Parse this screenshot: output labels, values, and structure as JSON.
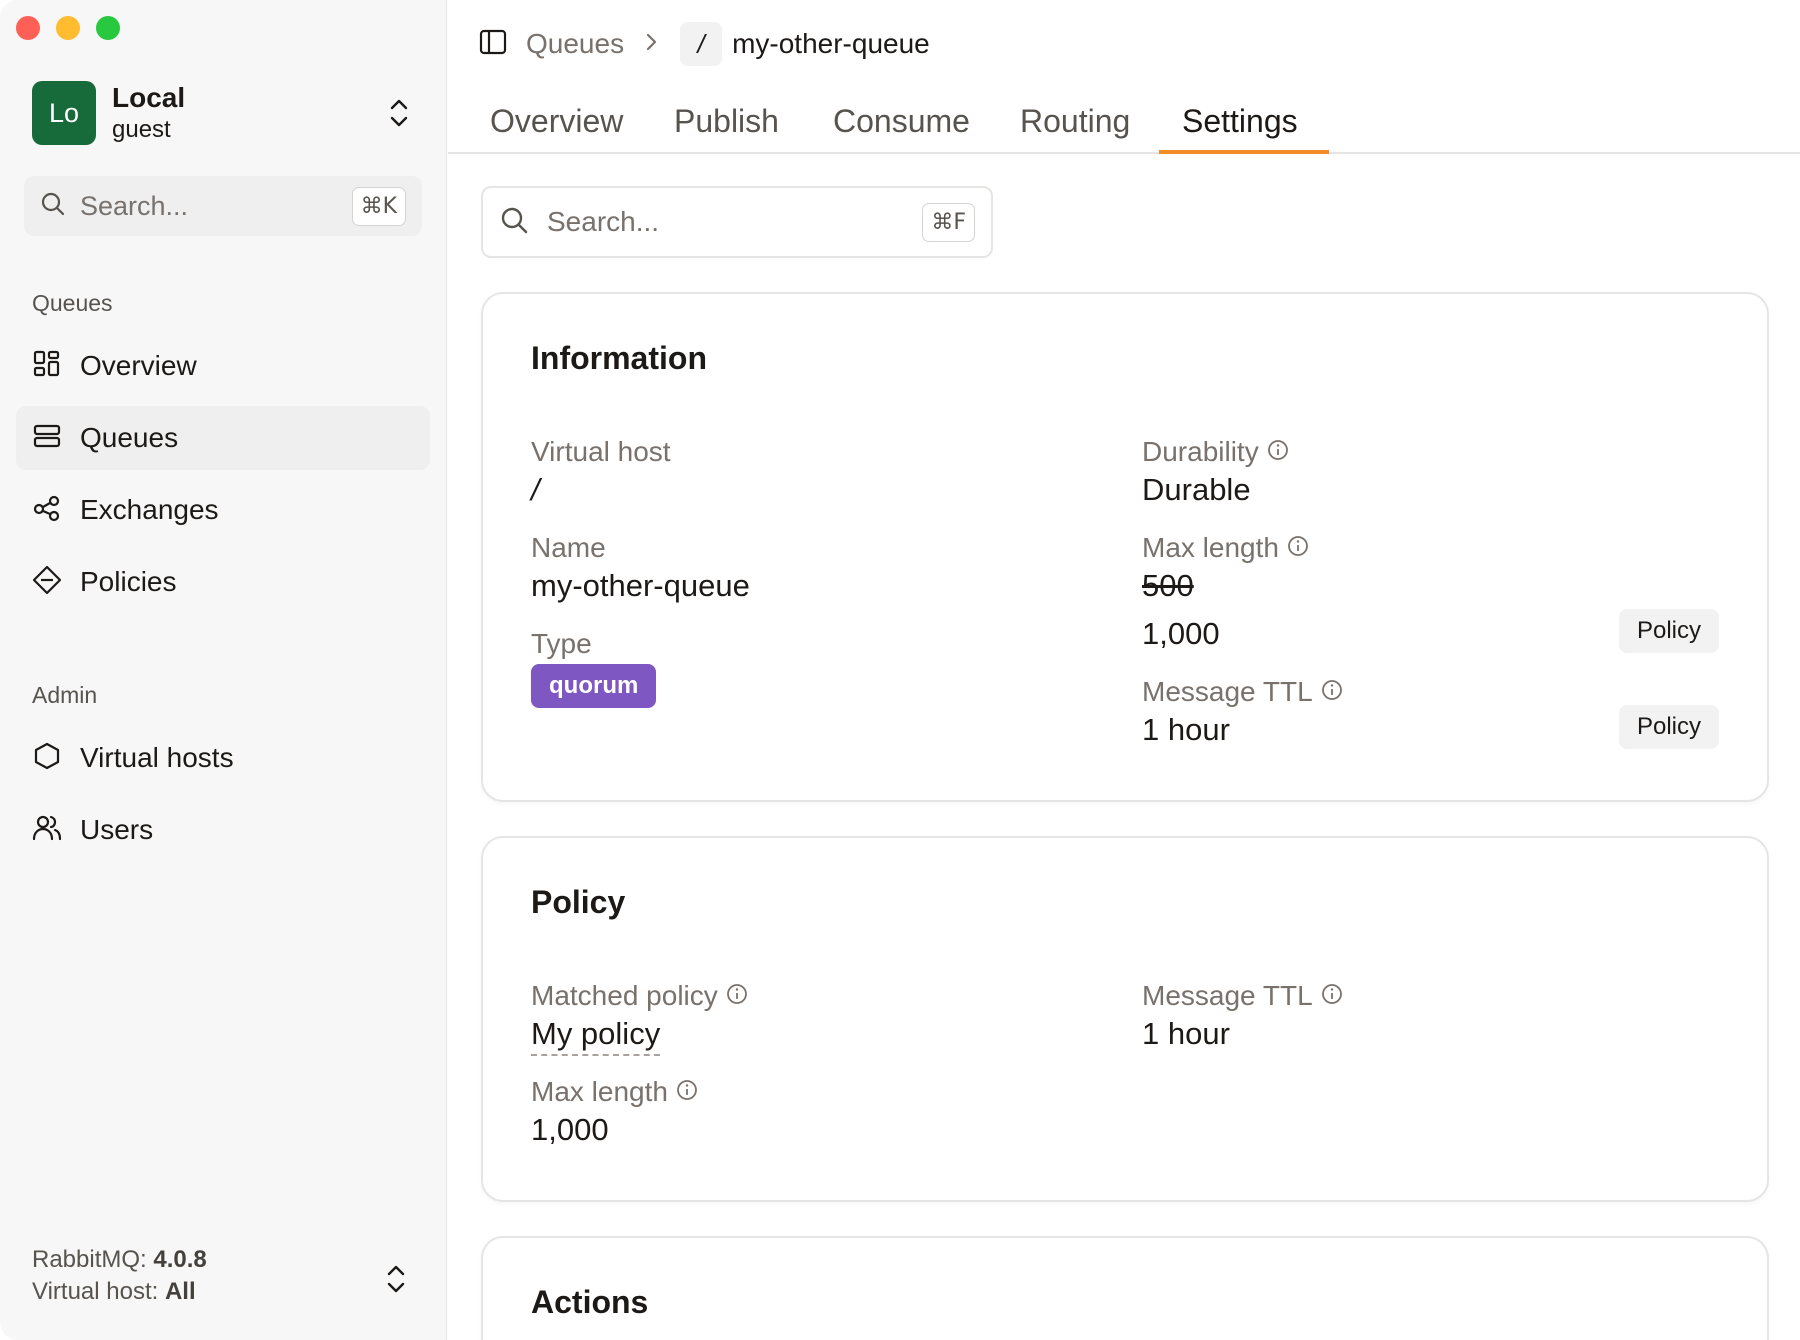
{
  "sidebar": {
    "account": {
      "initials": "Lo",
      "name": "Local",
      "user": "guest"
    },
    "search": {
      "placeholder": "Search...",
      "shortcut": "⌘K"
    },
    "sections": {
      "queues": "Queues",
      "admin": "Admin"
    },
    "items": [
      {
        "label": "Overview",
        "icon": "dashboard-grid-icon"
      },
      {
        "label": "Queues",
        "icon": "queue-stack-icon"
      },
      {
        "label": "Exchanges",
        "icon": "exchanges-share-icon"
      },
      {
        "label": "Policies",
        "icon": "policy-diamond-icon"
      },
      {
        "label": "Virtual hosts",
        "icon": "hexagon-icon"
      },
      {
        "label": "Users",
        "icon": "users-icon"
      }
    ],
    "footer": {
      "rabbit_label": "RabbitMQ:",
      "rabbit_version": "4.0.8",
      "vhost_label": "Virtual host:",
      "vhost_value": "All"
    }
  },
  "header": {
    "breadcrumb_root": "Queues",
    "vhost": "/",
    "queue_name": "my-other-queue"
  },
  "tabs": [
    {
      "label": "Overview"
    },
    {
      "label": "Publish"
    },
    {
      "label": "Consume"
    },
    {
      "label": "Routing"
    },
    {
      "label": "Settings"
    }
  ],
  "active_tab": "Settings",
  "search": {
    "placeholder": "Search...",
    "shortcut": "⌘F"
  },
  "information": {
    "title": "Information",
    "virtual_host": {
      "label": "Virtual host",
      "value": "/"
    },
    "name": {
      "label": "Name",
      "value": "my-other-queue"
    },
    "type": {
      "label": "Type",
      "value": "quorum"
    },
    "durability": {
      "label": "Durability",
      "value": "Durable"
    },
    "max_length": {
      "label": "Max length",
      "old_value": "500",
      "value": "1,000",
      "source": "Policy"
    },
    "message_ttl": {
      "label": "Message TTL",
      "value": "1 hour",
      "source": "Policy"
    }
  },
  "policy": {
    "title": "Policy",
    "matched_policy": {
      "label": "Matched policy",
      "value": "My policy"
    },
    "message_ttl": {
      "label": "Message TTL",
      "value": "1 hour"
    },
    "max_length": {
      "label": "Max length",
      "value": "1,000"
    }
  },
  "actions": {
    "title": "Actions"
  },
  "colors": {
    "accent": "#f28c28",
    "avatar": "#176b3a",
    "quorum_badge": "#7e57c2"
  }
}
